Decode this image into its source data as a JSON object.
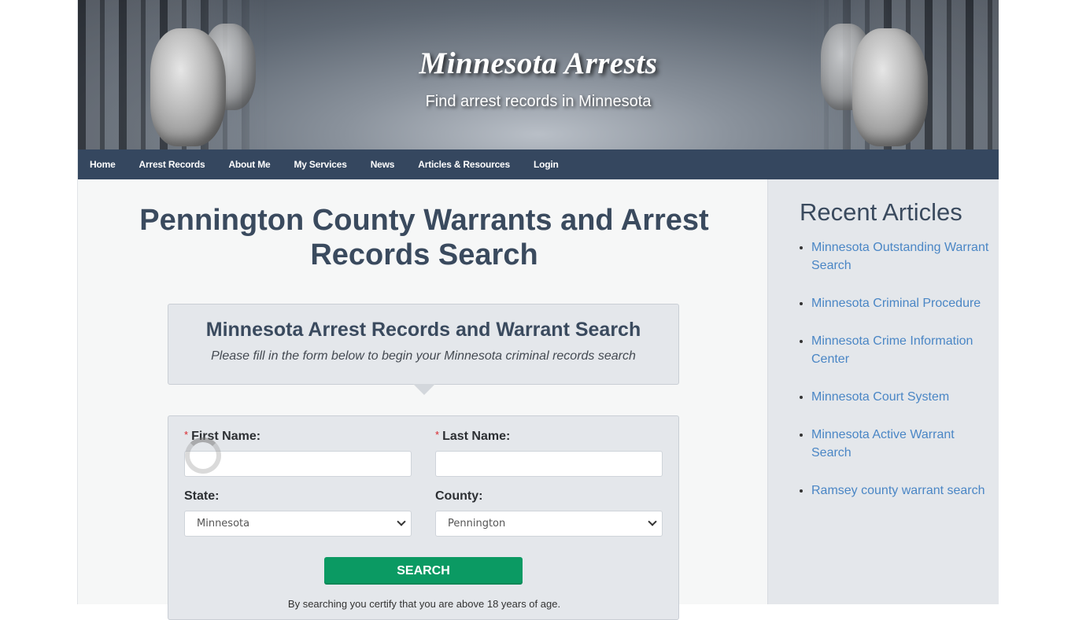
{
  "header": {
    "title": "Minnesota Arrests",
    "tagline": "Find arrest records in Minnesota"
  },
  "nav": {
    "items": [
      {
        "label": "Home"
      },
      {
        "label": "Arrest Records"
      },
      {
        "label": "About Me"
      },
      {
        "label": "My Services"
      },
      {
        "label": "News"
      },
      {
        "label": "Articles & Resources"
      },
      {
        "label": "Login"
      }
    ]
  },
  "main": {
    "page_title": "Pennington County Warrants and Arrest Records Search",
    "callout": {
      "heading": "Minnesota Arrest Records and Warrant Search",
      "subtext": "Please fill in the form below to begin your Minnesota criminal records search"
    },
    "form": {
      "required_marker": "*",
      "first_name": {
        "label": "First Name:",
        "value": ""
      },
      "last_name": {
        "label": "Last Name:",
        "value": ""
      },
      "state": {
        "label": "State:",
        "selected": "Minnesota"
      },
      "county": {
        "label": "County:",
        "selected": "Pennington"
      },
      "search_label": "SEARCH",
      "disclaimer": "By searching you certify that you are above 18 years of age."
    }
  },
  "sidebar": {
    "heading": "Recent Articles",
    "articles": [
      {
        "label": "Minnesota Outstanding Warrant Search"
      },
      {
        "label": "Minnesota Criminal Procedure"
      },
      {
        "label": "Minnesota Crime Information Center"
      },
      {
        "label": "Minnesota Court System"
      },
      {
        "label": "Minnesota Active Warrant Search"
      },
      {
        "label": "Ramsey county warrant search"
      }
    ]
  },
  "colors": {
    "nav_bg": "#35475f",
    "heading": "#3a4a5e",
    "link": "#4a86c5",
    "search_button": "#0b9a63",
    "required": "#d9262c"
  }
}
